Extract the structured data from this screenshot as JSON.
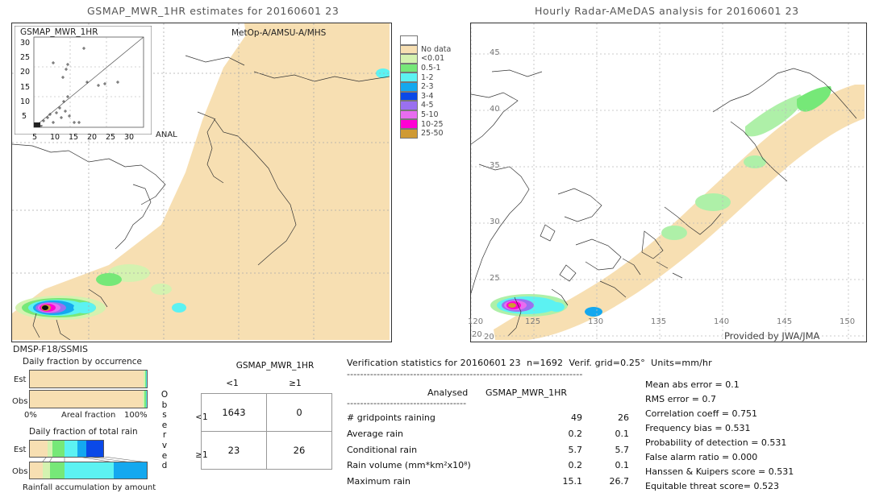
{
  "left_panel": {
    "title": "GSMAP_MWR_1HR estimates for 20160601 23",
    "inset_label": "GSMAP_MWR_1HR",
    "sensor_label_top": "MetOp-A/AMSU-A/MHS",
    "anal_label": "ANAL",
    "sensor_label_bottom": "DMSP-F18/SSMIS",
    "inset_y_ticks": [
      "30",
      "25",
      "20",
      "15",
      "10",
      "5"
    ],
    "inset_x_ticks": [
      "5",
      "10",
      "15",
      "20",
      "25",
      "30"
    ]
  },
  "right_panel": {
    "title": "Hourly Radar-AMeDAS analysis for 20160601 23",
    "credit": "Provided by JWA/JMA",
    "lat_ticks": [
      "45",
      "40",
      "35",
      "30",
      "25",
      "20"
    ],
    "lon_ticks": [
      "120",
      "125",
      "130",
      "135",
      "140",
      "145",
      "150"
    ],
    "lon_corner": "20"
  },
  "colorbar": {
    "entries": [
      {
        "label": "",
        "color": "#ffffff"
      },
      {
        "label": "No data",
        "color": "#f7dfb2"
      },
      {
        "label": "<0.01",
        "color": "#d4f2b0"
      },
      {
        "label": "0.5-1",
        "color": "#76e878"
      },
      {
        "label": "1-2",
        "color": "#5cf2f2"
      },
      {
        "label": "2-3",
        "color": "#14a8ef"
      },
      {
        "label": "3-4",
        "color": "#0a49e8"
      },
      {
        "label": "4-5",
        "color": "#9a70f0"
      },
      {
        "label": "5-10",
        "color": "#e86cf0"
      },
      {
        "label": "10-25",
        "color": "#ff00d4"
      },
      {
        "label": "25-50",
        "color": "#cf9a34"
      }
    ]
  },
  "fraction_panels": {
    "occurrence_title": "Daily fraction by occurrence",
    "total_rain_title": "Daily fraction of total rain",
    "bottom_caption": "Rainfall accumulation by amount",
    "axis_label": "Areal fraction",
    "axis_min": "0%",
    "axis_max": "100%",
    "row_est": "Est",
    "row_obs": "Obs",
    "occurrence_est": [
      {
        "color": "#f7dfb2",
        "pct": 97.5
      },
      {
        "color": "#d4f2b0",
        "pct": 1.0
      },
      {
        "color": "#76e878",
        "pct": 0.8
      },
      {
        "color": "#5cf2f2",
        "pct": 0.7
      }
    ],
    "occurrence_obs": [
      {
        "color": "#f7dfb2",
        "pct": 96.8
      },
      {
        "color": "#d4f2b0",
        "pct": 1.2
      },
      {
        "color": "#76e878",
        "pct": 1.0
      },
      {
        "color": "#5cf2f2",
        "pct": 1.0
      }
    ],
    "total_rain_est": [
      {
        "color": "#f7dfb2",
        "pct": 24.0
      },
      {
        "color": "#d4f2b0",
        "pct": 7.0
      },
      {
        "color": "#76e878",
        "pct": 16.0
      },
      {
        "color": "#5cf2f2",
        "pct": 18.0
      },
      {
        "color": "#14a8ef",
        "pct": 12.0
      },
      {
        "color": "#0a49e8",
        "pct": 23.0
      }
    ],
    "total_rain_obs": [
      {
        "color": "#f7dfb2",
        "pct": 11.0
      },
      {
        "color": "#d4f2b0",
        "pct": 6.0
      },
      {
        "color": "#76e878",
        "pct": 13.0
      },
      {
        "color": "#5cf2f2",
        "pct": 42.0
      },
      {
        "color": "#14a8ef",
        "pct": 28.0
      }
    ]
  },
  "contingency": {
    "title": "GSMAP_MWR_1HR",
    "col_headers": [
      "<1",
      "≥1"
    ],
    "row_headers": [
      "<1",
      "≥1"
    ],
    "cells": [
      [
        "1643",
        "0"
      ],
      [
        "23",
        "26"
      ]
    ],
    "observed_label": "Observed"
  },
  "verification": {
    "header": "Verification statistics for 20160601 23  n=1692  Verif. grid=0.25°  Units=mm/hr",
    "rule": "-----------------------------------------------------------------------",
    "col_header_analysed": "Analysed",
    "col_header_model": "GSMAP_MWR_1HR",
    "rule2": "------------------------------------",
    "rows": [
      {
        "label": "# gridpoints raining",
        "analysed": "49",
        "model": "26"
      },
      {
        "label": "Average rain",
        "analysed": "0.2",
        "model": "0.1"
      },
      {
        "label": "Conditional rain",
        "analysed": "5.7",
        "model": "5.7"
      },
      {
        "label": "Rain volume (mm*km²x10⁸)",
        "analysed": "0.2",
        "model": "0.1"
      },
      {
        "label": "Maximum rain",
        "analysed": "15.1",
        "model": "26.7"
      }
    ],
    "scores": [
      "Mean abs error = 0.1",
      "RMS error = 0.7",
      "Correlation coeff = 0.751",
      "Frequency bias = 0.531",
      "Probability of detection = 0.531",
      "False alarm ratio = 0.000",
      "Hanssen & Kuipers score = 0.531",
      "Equitable threat score= 0.523"
    ]
  }
}
